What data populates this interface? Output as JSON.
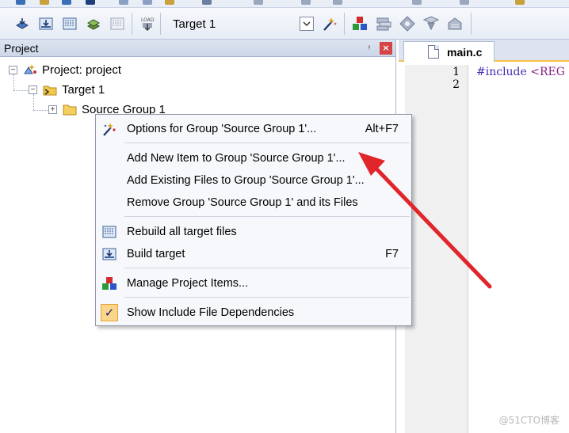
{
  "toolbar": {
    "target_value": "Target 1",
    "icons": [
      "translate-icon",
      "build-icon",
      "rebuild-icon",
      "batch-build-icon",
      "stop-build-icon",
      "download-icon",
      "target-options-icon",
      "manage-components-icon",
      "select-packs-icon",
      "manage-rte-icon",
      "pack-installer-icon",
      "extension-icon"
    ]
  },
  "project_panel": {
    "title": "Project",
    "pin_glyph": "ᵎ",
    "close_glyph": "×",
    "tree": {
      "root": "Project: project",
      "target": "Target 1",
      "group": "Source Group 1"
    }
  },
  "editor": {
    "tab_label": "main.c",
    "line_numbers": [
      "1",
      "2"
    ],
    "code_line1_directive": "#include",
    "code_line1_arg": "<REG"
  },
  "context_menu": {
    "items": [
      {
        "label": "Options for Group 'Source Group 1'...",
        "shortcut": "Alt+F7",
        "icon": "options-wand-icon"
      },
      {
        "label": "Add New  Item to Group 'Source Group 1'...",
        "shortcut": "",
        "icon": ""
      },
      {
        "label": "Add Existing Files to Group 'Source Group 1'...",
        "shortcut": "",
        "icon": ""
      },
      {
        "label": "Remove Group 'Source Group 1' and its Files",
        "shortcut": "",
        "icon": ""
      },
      {
        "label": "Rebuild all target files",
        "shortcut": "",
        "icon": "rebuild-icon"
      },
      {
        "label": "Build target",
        "shortcut": "F7",
        "icon": "build-icon"
      },
      {
        "label": "Manage Project Items...",
        "shortcut": "",
        "icon": "manage-items-icon"
      },
      {
        "label": "Show Include File Dependencies",
        "shortcut": "",
        "icon": "checkmark-icon"
      }
    ]
  },
  "watermark": "@51CTO博客",
  "colors": {
    "arrow": "#e0252b",
    "checked_bg": "#fbd68a",
    "close_button": "#d64545",
    "tab_underline": "#f6c24a"
  }
}
